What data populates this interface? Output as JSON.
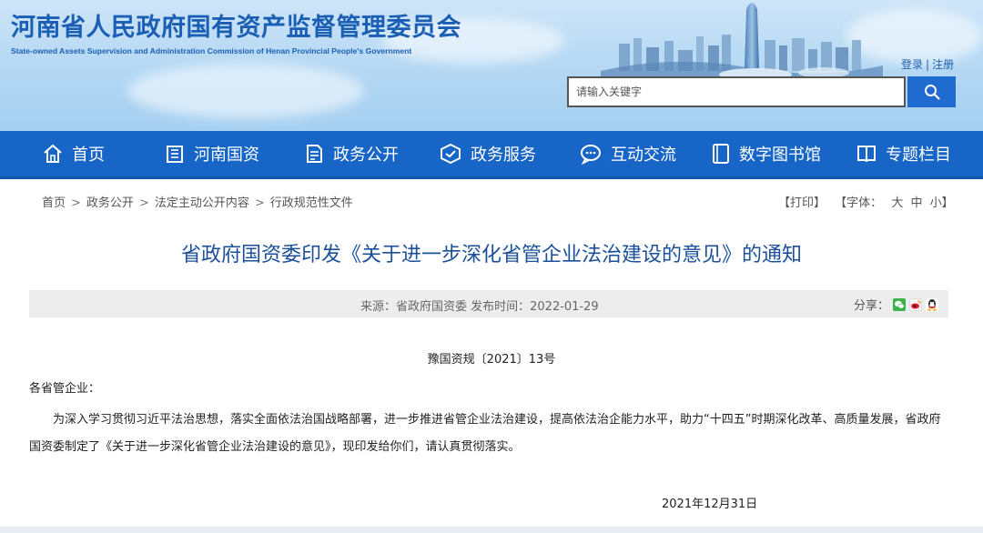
{
  "header": {
    "title": "河南省人民政府国有资产监督管理委员会",
    "subtitle": "State-owned Assets Supervision and Administration Commission of Henan Provincial People's Government",
    "login": "登录",
    "separator": "|",
    "register": "注册",
    "search_placeholder": "请输入关键字",
    "search_icon": "search-icon"
  },
  "nav": {
    "items": [
      {
        "label": "首页",
        "icon": "home-icon"
      },
      {
        "label": "河南国资",
        "icon": "building-icon"
      },
      {
        "label": "政务公开",
        "icon": "document-icon"
      },
      {
        "label": "政务服务",
        "icon": "service-icon"
      },
      {
        "label": "互动交流",
        "icon": "chat-icon"
      },
      {
        "label": "数字图书馆",
        "icon": "library-icon"
      },
      {
        "label": "专题栏目",
        "icon": "book-icon"
      }
    ]
  },
  "breadcrumb": {
    "items": [
      "首页",
      "政务公开",
      "法定主动公开内容",
      "行政规范性文件"
    ],
    "separator": ">"
  },
  "tools": {
    "print": "【打印】",
    "font_label": "【字体：",
    "font_large": "大",
    "font_medium": "中",
    "font_small": "小",
    "font_close": "】"
  },
  "article": {
    "title": "省政府国资委印发《关于进一步深化省管企业法治建设的意见》的通知",
    "meta": "来源：省政府国资委 发布时间：2022-01-29",
    "share_label": "分享：",
    "share_icons": [
      "wechat-icon",
      "weibo-icon",
      "qq-icon"
    ],
    "doc_number": "豫国资规〔2021〕13号",
    "greeting": "各省管企业：",
    "body": "为深入学习贯彻习近平法治思想，落实全面依法治国战略部署，进一步推进省管企业法治建设，提高依法治企能力水平，助力“十四五”时期深化改革、高质量发展，省政府国资委制定了《关于进一步深化省管企业法治建设的意见》，现印发给你们，请认真贯彻落实。",
    "date": "2021年12月31日"
  },
  "colors": {
    "nav_bg": "#1665c7",
    "title_blue": "#1b4f9a",
    "header_text": "#1b5fb4"
  }
}
